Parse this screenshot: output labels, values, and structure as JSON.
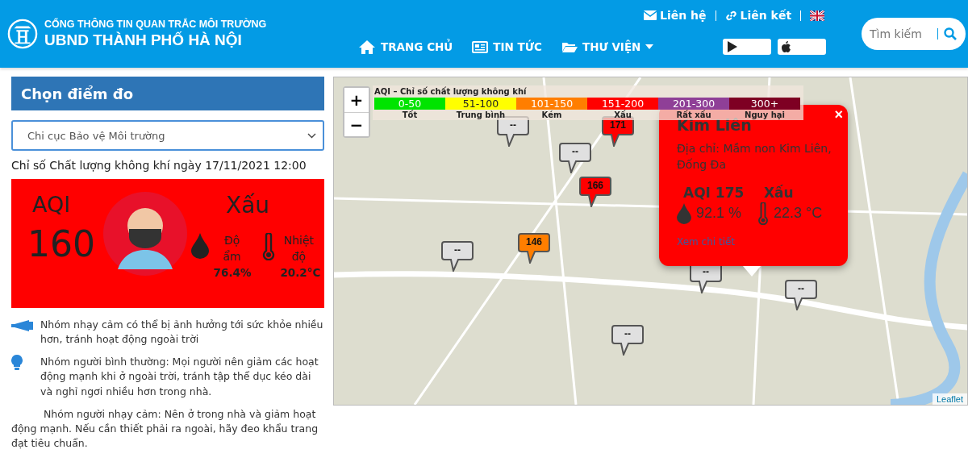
{
  "header": {
    "subtitle": "CỔNG THÔNG TIN QUAN TRẮC MÔI TRƯỜNG",
    "title": "UBND THÀNH PHỐ HÀ NỘI",
    "top_links": [
      {
        "kind": "mail",
        "label": "Liên hệ"
      },
      {
        "kind": "link",
        "label": "Liên kết"
      }
    ],
    "nav": [
      {
        "kind": "home",
        "label": "TRANG CHỦ",
        "dropdown": false
      },
      {
        "kind": "news",
        "label": "TIN TỨC",
        "dropdown": false
      },
      {
        "kind": "folder",
        "label": "THƯ VIỆN",
        "dropdown": true
      }
    ],
    "search": {
      "placeholder": "Tìm kiếm"
    }
  },
  "sidebar": {
    "heading": "Chọn điểm đo",
    "station_select": {
      "value": "Chi cục Bảo vệ Môi trường"
    },
    "date_line": "Chỉ số Chất lượng không khí ngày 17/11/2021 12:00",
    "aqi_card": {
      "color": "#ff0000",
      "label": "AQI",
      "value": "160",
      "status": "Xấu",
      "humidity_label": "Độ ẩm",
      "humidity": "76.4%",
      "temperature_label": "Nhiệt độ",
      "temperature": "20.2°C"
    },
    "advice": [
      {
        "kind": "megaphone",
        "text": "Nhóm nhạy cảm có thể bị ảnh hưởng tới sức khỏe nhiều hơn, tránh hoạt động ngoài trời"
      },
      {
        "kind": "bulb",
        "text": "Nhóm người bình thường: Mọi người nên giảm các hoạt động mạnh khi ở ngoài trời, tránh tập thể dục kéo dài và nghỉ ngơi nhiều hơn trong nhà."
      },
      {
        "kind": "none",
        "text": "Nhóm người nhạy cảm: Nên ở trong nhà và giảm hoạt động mạnh. Nếu cần thiết phải ra ngoài, hãy đeo khẩu trang đạt tiêu chuẩn."
      }
    ]
  },
  "map": {
    "zoom_in": "+",
    "zoom_out": "−",
    "attribution": "Leaflet",
    "legend": {
      "title": "AQI – Chỉ số chất lượng không khí",
      "levels": [
        {
          "range": "0-50",
          "label": "Tốt",
          "color": "#00e400"
        },
        {
          "range": "51-100",
          "label": "Trung bình",
          "color": "#ffff00"
        },
        {
          "range": "101-150",
          "label": "Kém",
          "color": "#ff7e00"
        },
        {
          "range": "151-200",
          "label": "Xấu",
          "color": "#ff0000"
        },
        {
          "range": "201-300",
          "label": "Rất xấu",
          "color": "#8f3f97"
        },
        {
          "range": "300+",
          "label": "Nguy hại",
          "color": "#7e0023"
        }
      ]
    },
    "markers": [
      {
        "value": "--",
        "color": "#e0e0e0"
      },
      {
        "value": "171",
        "color": "#ff0000"
      },
      {
        "value": "--",
        "color": "#e0e0e0"
      },
      {
        "value": "166",
        "color": "#ff0000"
      },
      {
        "value": "146",
        "color": "#ff7e00"
      },
      {
        "value": "--",
        "color": "#e0e0e0"
      },
      {
        "value": "--",
        "color": "#e0e0e0"
      },
      {
        "value": "--",
        "color": "#e0e0e0"
      },
      {
        "value": "--",
        "color": "#e0e0e0"
      }
    ],
    "popup": {
      "color": "#ff0000",
      "close": "×",
      "title": "Kim Liên",
      "address": "Địa chỉ: Mầm non Kim Liên, Đống Đa",
      "aqi": "AQI 175",
      "status": "Xấu",
      "humidity": "92.1 %",
      "temperature": "22.3 °C",
      "link": "Xem chi tiết"
    }
  }
}
